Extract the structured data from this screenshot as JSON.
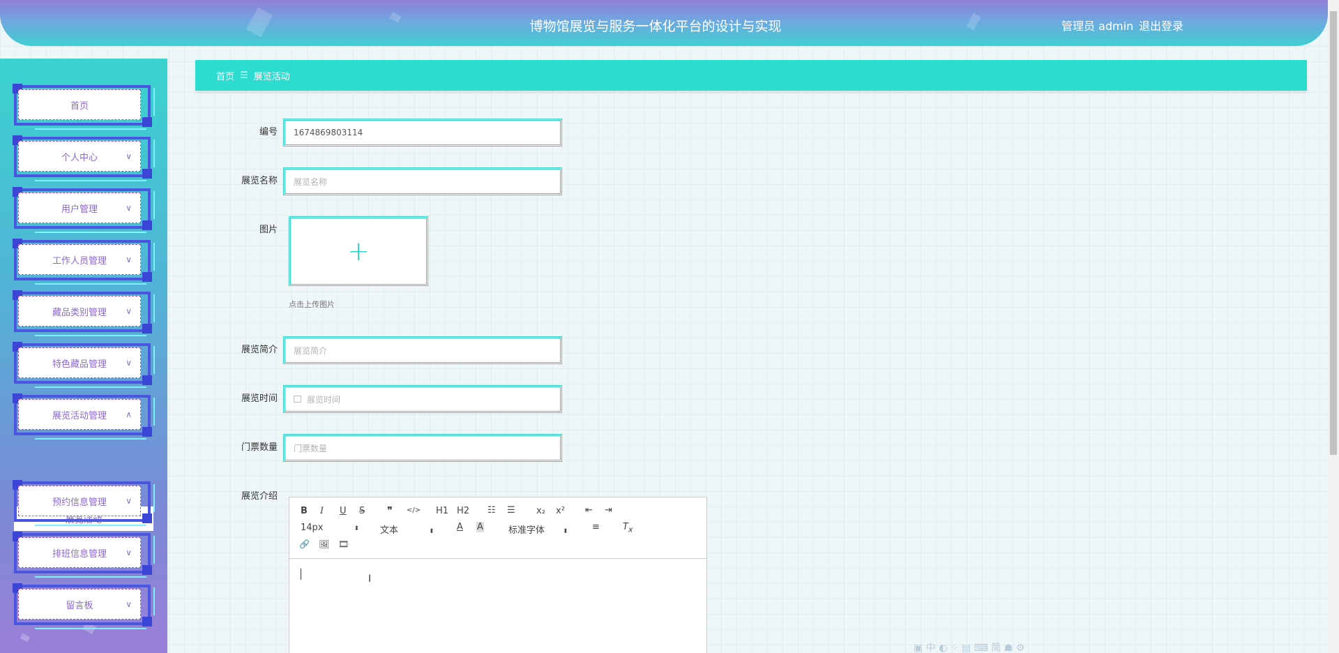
{
  "header": {
    "title": "博物馆展览与服务一体化平台的设计与实现",
    "user": "管理员 admin",
    "logout": "退出登录"
  },
  "sidebar": {
    "items": [
      {
        "label": "首页",
        "chevron": ""
      },
      {
        "label": "个人中心",
        "chevron": "∨"
      },
      {
        "label": "用户管理",
        "chevron": "∨"
      },
      {
        "label": "工作人员管理",
        "chevron": "∨"
      },
      {
        "label": "藏品类别管理",
        "chevron": "∨"
      },
      {
        "label": "特色藏品管理",
        "chevron": "∨"
      },
      {
        "label": "展览活动管理",
        "chevron": "∧"
      },
      {
        "label": "预约信息管理",
        "chevron": "∨"
      },
      {
        "label": "排班信息管理",
        "chevron": "∨"
      },
      {
        "label": "留言板",
        "chevron": "∨"
      }
    ],
    "sub_item": "展览活动"
  },
  "breadcrumb": {
    "home": "首页",
    "separator": "☰",
    "current": "展览活动"
  },
  "form": {
    "id": {
      "label": "编号",
      "value": "1674869803114"
    },
    "name": {
      "label": "展览名称",
      "placeholder": "展览名称"
    },
    "image": {
      "label": "图片",
      "plus": "+",
      "tip": "点击上传图片"
    },
    "intro": {
      "label": "展览简介",
      "placeholder": "展览简介"
    },
    "time": {
      "label": "展览时间",
      "placeholder": "展览时间",
      "icon": "calendar-icon"
    },
    "tickets": {
      "label": "门票数量",
      "placeholder": "门票数量"
    },
    "description": {
      "label": "展览介绍"
    }
  },
  "editor": {
    "row1": [
      "B",
      "I",
      "U",
      "S",
      "❞",
      "</>",
      "H1",
      "H2",
      "☷",
      "☰",
      "x₂",
      "x²",
      "⇤",
      "⇥"
    ],
    "font_size": "14px",
    "header_select": "文本",
    "font_family": "标准字体",
    "row3": [
      "🔗",
      "🖼",
      "🎞"
    ]
  },
  "colors": {
    "accent": "#2cdccf",
    "menu_text": "#8a6ad0",
    "frame": "#4b56e0"
  }
}
